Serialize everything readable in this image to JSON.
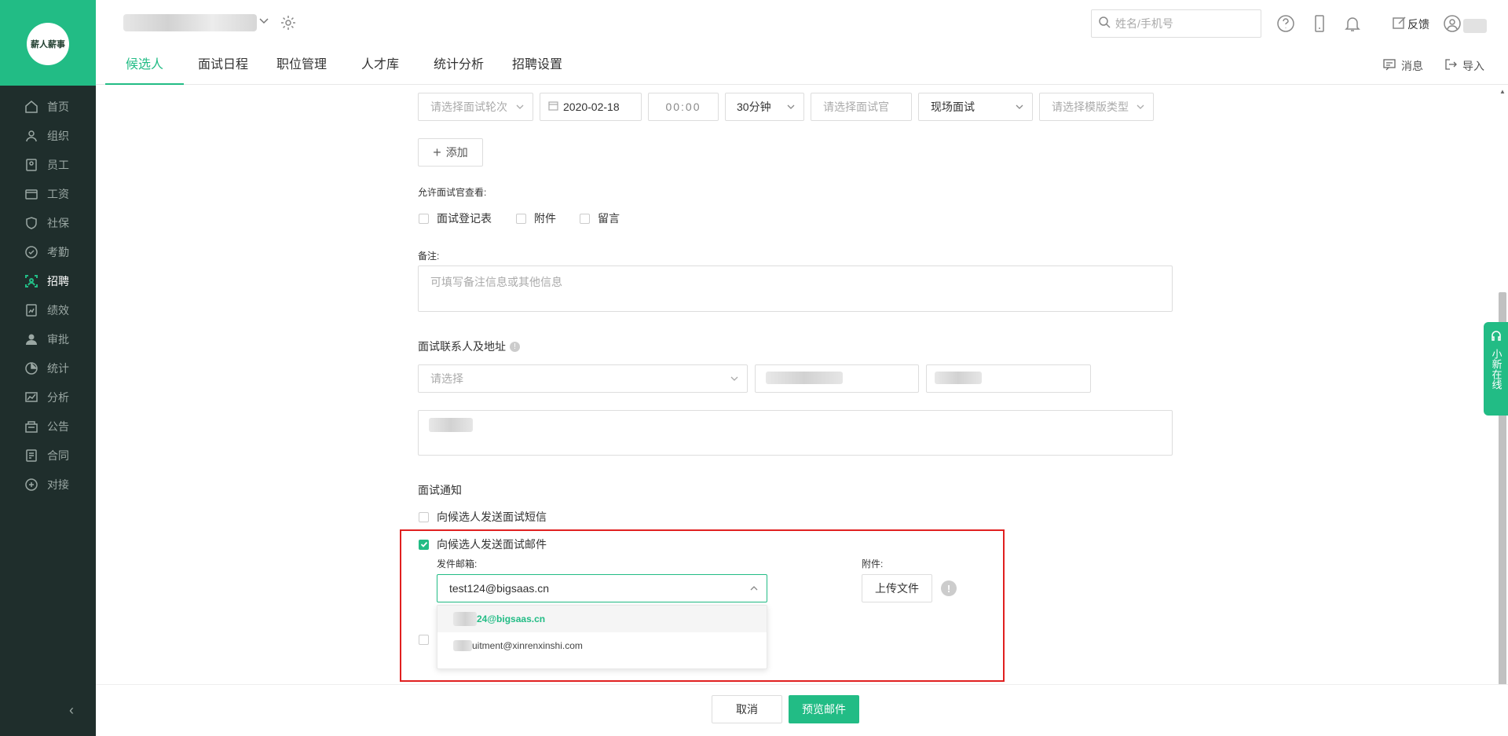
{
  "brand": {
    "logo_text": "薪人薪事"
  },
  "sidebar": {
    "items": [
      {
        "label": "首页",
        "icon": "home-icon"
      },
      {
        "label": "组织",
        "icon": "org-icon"
      },
      {
        "label": "员工",
        "icon": "employee-icon"
      },
      {
        "label": "工资",
        "icon": "salary-icon"
      },
      {
        "label": "社保",
        "icon": "shield-icon"
      },
      {
        "label": "考勤",
        "icon": "attendance-icon"
      },
      {
        "label": "招聘",
        "icon": "recruit-icon",
        "active": true
      },
      {
        "label": "绩效",
        "icon": "performance-icon"
      },
      {
        "label": "审批",
        "icon": "approval-icon"
      },
      {
        "label": "统计",
        "icon": "pie-icon"
      },
      {
        "label": "分析",
        "icon": "analysis-icon"
      },
      {
        "label": "公告",
        "icon": "notice-icon"
      },
      {
        "label": "合同",
        "icon": "contract-icon"
      },
      {
        "label": "对接",
        "icon": "integration-icon"
      }
    ]
  },
  "topbar": {
    "search_placeholder": "姓名/手机号",
    "feedback": "反馈"
  },
  "tabs": [
    "候选人",
    "面试日程",
    "职位管理",
    "人才库",
    "统计分析",
    "招聘设置"
  ],
  "tab_actions": {
    "message": "消息",
    "import": "导入"
  },
  "form": {
    "round_placeholder": "请选择面试轮次",
    "date": "2020-02-18",
    "time": "00:00",
    "duration": "30分钟",
    "interviewer_placeholder": "请选择面试官",
    "mode": "现场面试",
    "template_placeholder": "请选择模版类型",
    "add": "添加",
    "allow_view_label": "允许面试官查看:",
    "allow_view_options": [
      "面试登记表",
      "附件",
      "留言"
    ],
    "remark_label": "备注:",
    "remark_placeholder": "可填写备注信息或其他信息",
    "contact_label": "面试联系人及地址",
    "contact_placeholder": "请选择",
    "notify_label": "面试通知",
    "sms_option": "向候选人发送面试短信",
    "email_option": "向候选人发送面试邮件",
    "sender_label": "发件邮箱:",
    "sender_value": "test124@bigsaas.cn",
    "attachment_label": "附件:",
    "upload": "上传文件",
    "dropdown": [
      "24@bigsaas.cn",
      "uitment@xinrenxinshi.com"
    ]
  },
  "footer": {
    "cancel": "取消",
    "preview": "预览邮件"
  },
  "online_service": "小新在线",
  "colors": {
    "accent": "#22bc85",
    "sidebar": "#1f2e2c",
    "highlight": "#e02020"
  }
}
